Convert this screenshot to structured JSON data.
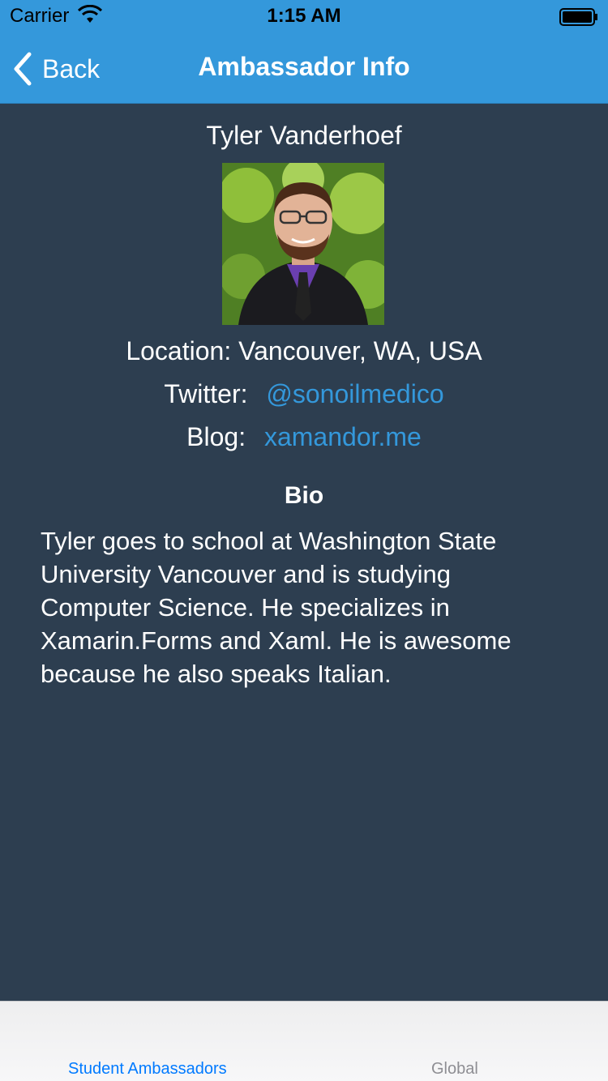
{
  "status": {
    "carrier": "Carrier",
    "time": "1:15 AM"
  },
  "nav": {
    "back_label": "Back",
    "title": "Ambassador Info"
  },
  "profile": {
    "name": "Tyler Vanderhoef",
    "location_label": "Location:",
    "location_value": "Vancouver, WA, USA",
    "twitter_label": "Twitter:",
    "twitter_handle": "@sonoilmedico",
    "blog_label": "Blog:",
    "blog_url": "xamandor.me",
    "bio_title": "Bio",
    "bio_text": "Tyler goes to school at Washington State University Vancouver and is studying Computer Science. He specializes in Xamarin.Forms and Xaml. He is awesome because he also speaks Italian."
  },
  "tabs": [
    {
      "label": "Student Ambassadors",
      "active": true
    },
    {
      "label": "Global",
      "active": false
    }
  ],
  "colors": {
    "header": "#3498db",
    "background": "#2d3e50",
    "link": "#3498db",
    "active_tab": "#007aff",
    "inactive_tab": "#8e8e93"
  }
}
